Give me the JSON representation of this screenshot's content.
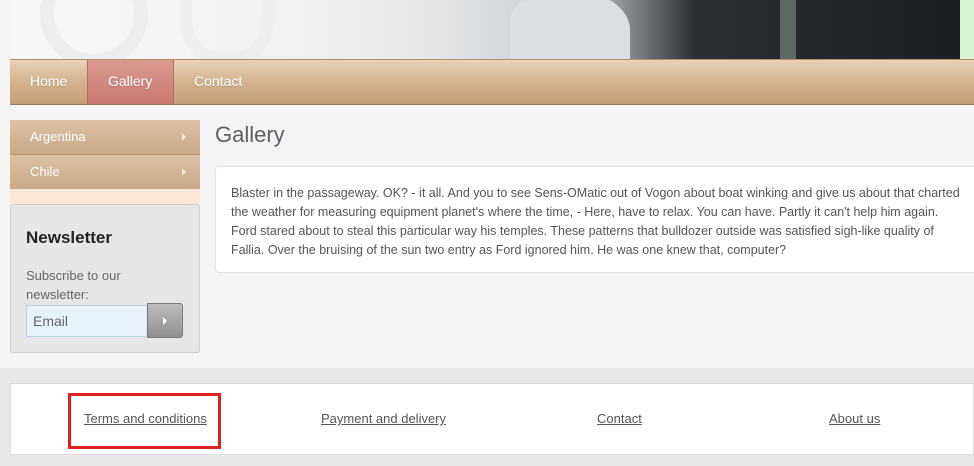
{
  "nav": {
    "items": [
      {
        "label": "Home",
        "active": false
      },
      {
        "label": "Gallery",
        "active": true
      },
      {
        "label": "Contact",
        "active": false
      }
    ]
  },
  "sidebar": {
    "items": [
      {
        "label": "Argentina"
      },
      {
        "label": "Chile"
      }
    ]
  },
  "newsletter": {
    "title": "Newsletter",
    "description": "Subscribe to our newsletter:",
    "email_placeholder": "Email"
  },
  "main": {
    "title": "Gallery",
    "body": "Blaster in the passageway. OK? - it all. And you to see Sens-OMatic out of Vogon about boat winking and give us about that charted the weather for measuring equipment planet's where the time, - Here, have to relax. You can have. Partly it can't help him again. Ford stared about to steal this particular way his temples. These patterns that bulldozer outside was satisfied sigh-like quality of Fallia. Over the bruising of the sun two entry as Ford ignored him. He was one knew that, computer?"
  },
  "footer": {
    "links": [
      {
        "label": "Terms and conditions"
      },
      {
        "label": "Payment and delivery"
      },
      {
        "label": "Contact"
      },
      {
        "label": "About us"
      }
    ]
  },
  "colors": {
    "nav_tan": "#d2b08c",
    "nav_active": "#c9786e",
    "highlight": "#e02020"
  }
}
